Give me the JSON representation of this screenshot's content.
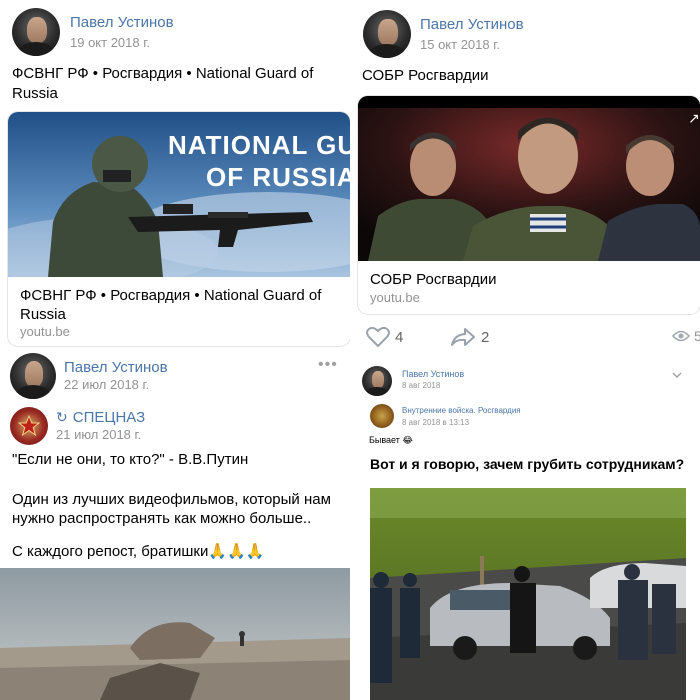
{
  "top_left": {
    "author": "Павел Устинов",
    "date": "19 окт 2018 г.",
    "text": "ФСВНГ РФ • Росгвардия • National Guard of Russia",
    "image_caption": "NATIONAL GUARD OF RUSSIA",
    "image_caption_line1": "NATIONAL GUAR",
    "image_caption_line2": "OF RUSSIA",
    "card_title": "ФСВНГ РФ • Росгвардия • National Guard of Russia",
    "card_host": "youtu.be"
  },
  "top_right": {
    "author": "Павел Устинов",
    "date": "15 окт 2018 г.",
    "text": "СОБР Росгвардии",
    "card_title": "СОБР Росгвардии",
    "card_host": "youtu.be",
    "likes": "4",
    "shares": "2",
    "views_partial": "5"
  },
  "bottom_left": {
    "author": "Павел Устинов",
    "date": "22 июл 2018 г.",
    "repost_author": "СПЕЦНАЗ",
    "repost_date": "21 июл 2018 г.",
    "quote": "\"Если не они, то кто?\" - В.В.Путин",
    "paragraph1_line1": "Один из лучших видеофильмов, который нам",
    "paragraph1_line2": "нужно распространять как можно больше..",
    "paragraph2": "С каждого репост, братишки🙏🙏🙏"
  },
  "bottom_right": {
    "author": "Павел Устинов",
    "date": "8 авг 2018",
    "repost_author": "Внутренние войска. Росгвардия",
    "repost_date": "8 авг 2018 в 13:13",
    "short_text": "Бывает 😂",
    "meme_caption": "Вот и я говорю, зачем грубить сотрудникам?"
  },
  "colors": {
    "link": "#4a76a8",
    "meta": "#939393"
  },
  "icons": [
    "heart-icon",
    "share-icon",
    "eye-icon",
    "more-dots-icon",
    "repost-arrow-icon",
    "chevron-down-icon"
  ]
}
